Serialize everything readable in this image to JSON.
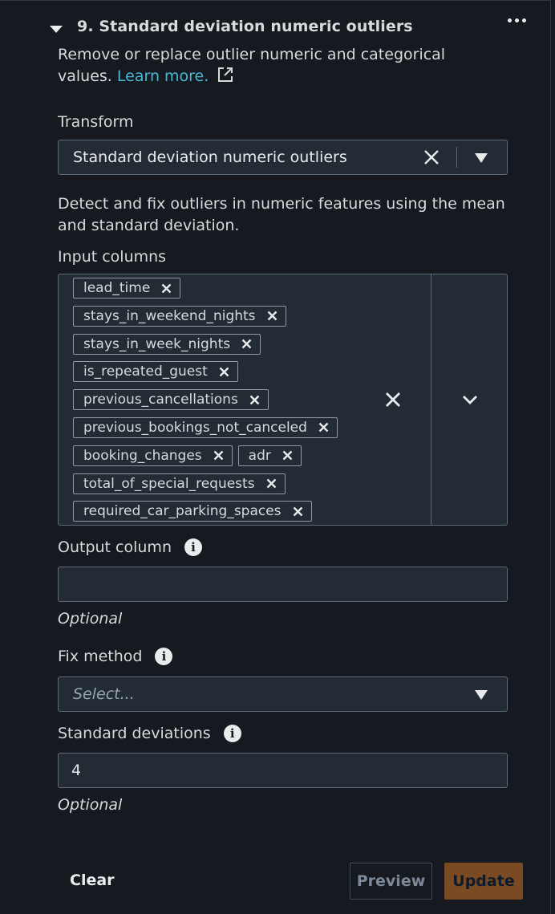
{
  "step": {
    "title": "9. Standard deviation numeric outliers",
    "description": "Remove or replace outlier numeric and categorical values.",
    "learn_more": "Learn more."
  },
  "transform": {
    "label": "Transform",
    "selected": "Standard deviation numeric outliers",
    "hint": "Detect and fix outliers in numeric features using the mean and standard deviation."
  },
  "input_columns": {
    "label": "Input columns",
    "rows": [
      [
        "lead_time"
      ],
      [
        "stays_in_weekend_nights"
      ],
      [
        "stays_in_week_nights"
      ],
      [
        "is_repeated_guest"
      ],
      [
        "previous_cancellations"
      ],
      [
        "previous_bookings_not_canceled"
      ],
      [
        "booking_changes",
        "adr"
      ],
      [
        "total_of_special_requests"
      ],
      [
        "required_car_parking_spaces"
      ]
    ]
  },
  "output_column": {
    "label": "Output column",
    "value": "",
    "note": "Optional"
  },
  "fix_method": {
    "label": "Fix method",
    "placeholder": "Select..."
  },
  "std_devs": {
    "label": "Standard deviations",
    "value": "4",
    "note": "Optional"
  },
  "actions": {
    "clear": "Clear",
    "preview": "Preview",
    "update": "Update"
  },
  "colors": {
    "accent_link": "#44b9d6",
    "update_bg": "#7a4a23",
    "panel_bg": "#16191f",
    "field_bg": "#232b35"
  }
}
